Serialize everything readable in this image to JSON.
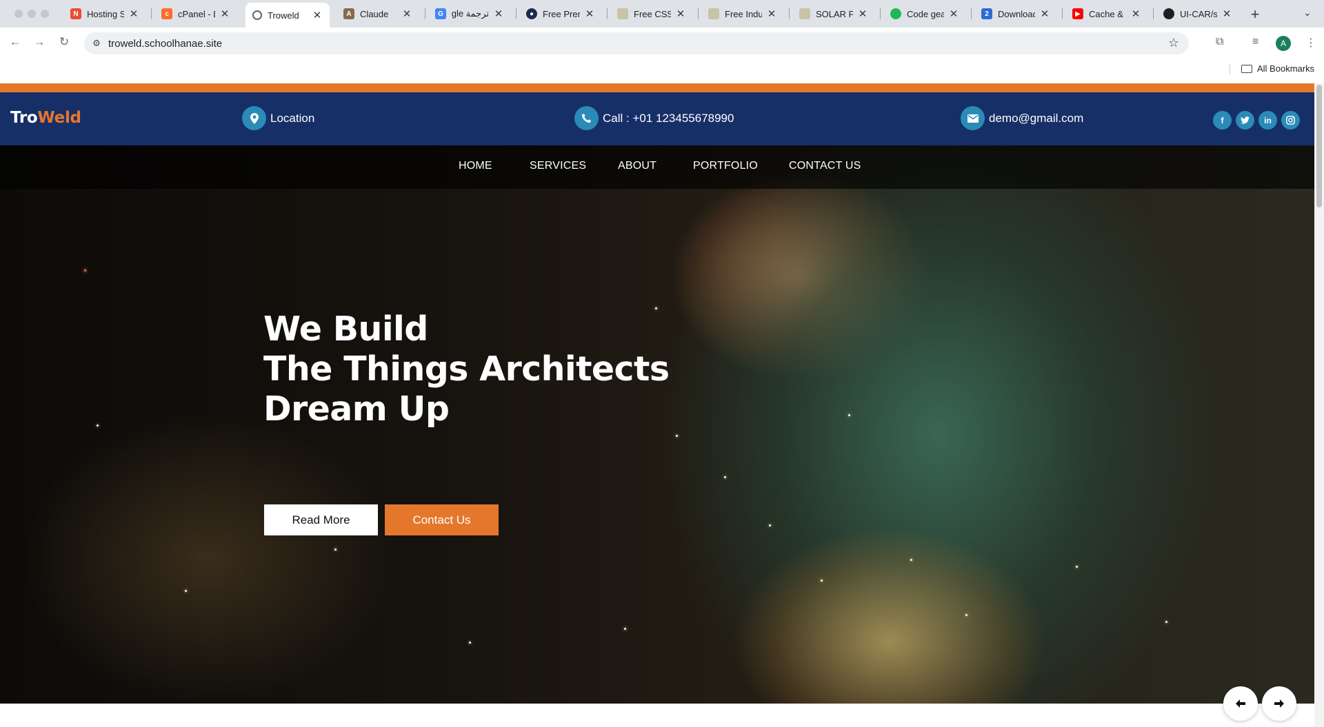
{
  "browser": {
    "tabs": [
      {
        "title": "Hosting Su",
        "icon": "hosting-favicon",
        "color": "#e94d35"
      },
      {
        "title": "cPanel - D",
        "icon": "cpanel-favicon",
        "color": "#ff6c2c"
      },
      {
        "title": "Troweld",
        "icon": "globe-favicon",
        "color": "#5f6368",
        "active": true
      },
      {
        "title": "Claude",
        "icon": "claude-favicon",
        "color": "#8a6a4a"
      },
      {
        "title": "ترجمة Google",
        "icon": "google-translate-favicon",
        "color": "#4285f4"
      },
      {
        "title": "Free Premi",
        "icon": "premium-favicon",
        "color": "#1b2a4e"
      },
      {
        "title": "Free CSS |",
        "icon": "freecss-favicon",
        "color": "#c9c3a7"
      },
      {
        "title": "Free Indus",
        "icon": "freeindus-favicon",
        "color": "#c9c3a7"
      },
      {
        "title": "SOLAR Fre",
        "icon": "solar-favicon",
        "color": "#c9c3a7"
      },
      {
        "title": "Code geas",
        "icon": "spotify-favicon",
        "color": "#1db954"
      },
      {
        "title": "Download",
        "icon": "download-favicon",
        "color": "#2b6bd6",
        "glyph": "2"
      },
      {
        "title": "Cache & C",
        "icon": "youtube-favicon",
        "color": "#ff0000"
      },
      {
        "title": "UI-CAR/sr",
        "icon": "github-favicon",
        "color": "#1f1f1f"
      }
    ],
    "url": "troweld.schoolhanae.site",
    "avatar_letter": "A",
    "bookmarks_label": "All Bookmarks"
  },
  "site": {
    "logo_part1": "Tro",
    "logo_part2": "Weld",
    "location_label": "Location",
    "phone_label": "Call : +01 123455678990",
    "email_label": "demo@gmail.com",
    "socials": [
      "f",
      "t",
      "in",
      "ig"
    ],
    "nav": [
      "HOME",
      "SERVICES",
      "ABOUT",
      "PORTFOLIO",
      "CONTACT US"
    ],
    "hero": {
      "line1": "We Build",
      "line2": "The Things Architects",
      "line3": "Dream Up",
      "read_more": "Read More",
      "contact_us": "Contact Us"
    },
    "colors": {
      "accent": "#e5772d",
      "topbar": "#162f67",
      "icon_circle": "#2b8bb8"
    }
  }
}
